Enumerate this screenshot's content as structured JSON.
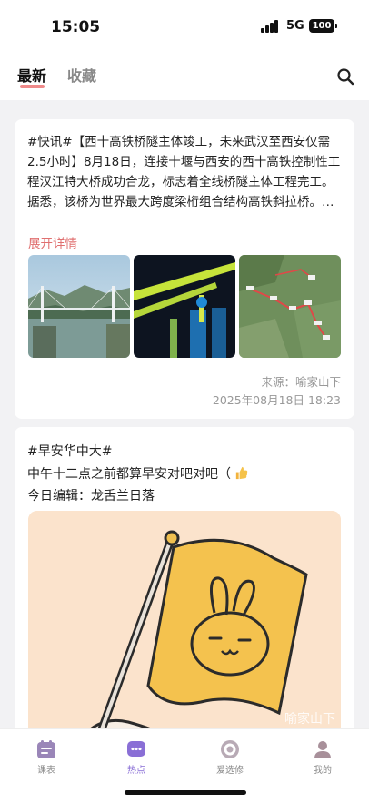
{
  "status": {
    "time": "15:05",
    "network": "5G",
    "battery": "100"
  },
  "tabs": {
    "active": "最新",
    "inactive": "收藏"
  },
  "posts": [
    {
      "body": "#快讯#【西十高铁桥隧主体竣工，未来武汉至西安仅需2.5小时】8月18日，连接十堰与西安的西十高铁控制性工程汉江特大桥成功合龙，标志着全线桥隧主体工程完工。据悉，该桥为世界最大跨度梁桁组合结构高铁斜拉桥。…",
      "more": "展开详情",
      "source": "来源：喻家山下",
      "date": "2025年08月18日 18:23"
    },
    {
      "tag": "#早安华中大#",
      "line": "中午十二点之前都算早安对吧对吧（",
      "editor": "今日编辑：龙舌兰日落",
      "watermark": "喻家山下"
    }
  ],
  "nav": [
    {
      "label": "课表",
      "icon": "calendar-icon"
    },
    {
      "label": "热点",
      "icon": "chat-bubble-icon"
    },
    {
      "label": "爱选修",
      "icon": "target-icon"
    },
    {
      "label": "我的",
      "icon": "person-icon"
    }
  ],
  "colors": {
    "accent": "#ef8a8a",
    "nav_active": "#8a6fd6"
  }
}
